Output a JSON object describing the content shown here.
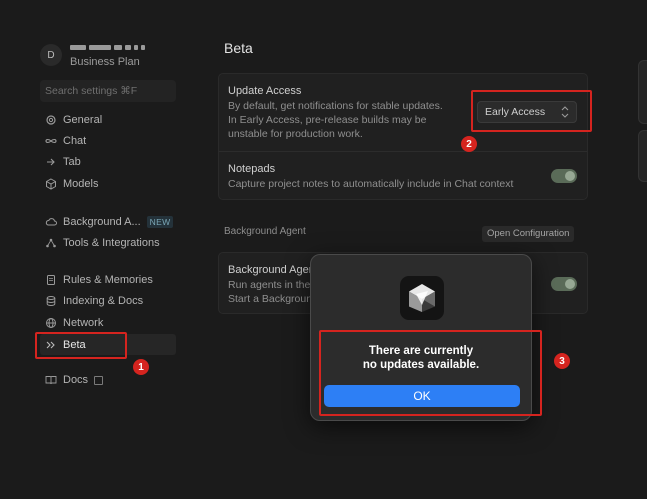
{
  "sidebar": {
    "avatar_initial": "D",
    "plan": "Business Plan",
    "search_placeholder": "Search settings ⌘F",
    "items": [
      {
        "label": "General",
        "icon": "gear-icon"
      },
      {
        "label": "Chat",
        "icon": "infinity-icon"
      },
      {
        "label": "Tab",
        "icon": "arrow-right-icon"
      },
      {
        "label": "Models",
        "icon": "cube-icon"
      },
      {
        "label": "Background A...",
        "icon": "cloud-icon",
        "badge": "NEW"
      },
      {
        "label": "Tools & Integrations",
        "icon": "tools-icon"
      },
      {
        "label": "Rules & Memories",
        "icon": "document-icon"
      },
      {
        "label": "Indexing & Docs",
        "icon": "database-icon"
      },
      {
        "label": "Network",
        "icon": "globe-icon"
      },
      {
        "label": "Beta",
        "icon": "chevrons-right-icon"
      },
      {
        "label": "Docs",
        "icon": "book-icon"
      }
    ]
  },
  "main": {
    "title": "Beta",
    "update_access": {
      "title": "Update Access",
      "description_lines": [
        "By default, get notifications for stable updates.",
        "In Early Access, pre-release builds may be",
        "unstable for production work."
      ],
      "selected": "Early Access"
    },
    "notepads": {
      "title": "Notepads",
      "description": "Capture project notes to automatically include in Chat context",
      "enabled": true
    },
    "background_agent": {
      "section_label": "Background Agent",
      "open_config_label": "Open Configuration",
      "title": "Background Agent",
      "desc_line1": "Run agents in the",
      "desc_line2": "Start a Background",
      "enabled": true
    }
  },
  "dialog": {
    "message_line1": "There are currently",
    "message_line2": "no updates available.",
    "ok_label": "OK"
  },
  "annotations": [
    "1",
    "2",
    "3"
  ],
  "colors": {
    "highlight": "#d5241f",
    "ok_button": "#2d7ff5",
    "background": "#1b1b1b"
  }
}
